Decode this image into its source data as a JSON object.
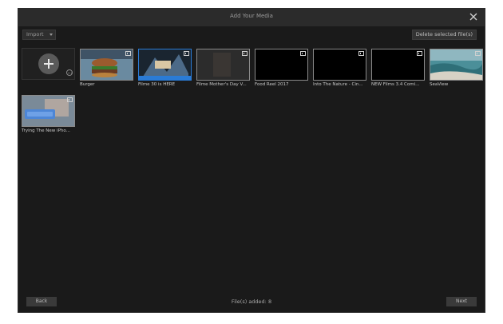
{
  "window": {
    "title": "Add Your Media"
  },
  "toolbar": {
    "import_label": "Import",
    "delete_label": "Delete selected file(s)"
  },
  "media": [
    {
      "name": "Burger"
    },
    {
      "name": "Filme 30 is HERE"
    },
    {
      "name": "Filme Mother's Day V..."
    },
    {
      "name": "Food Reel 2017"
    },
    {
      "name": "Into The Nature - Cin..."
    },
    {
      "name": "NEW Films 3.4 Comi..."
    },
    {
      "name": "SeaView"
    },
    {
      "name": "Trying The New iPho..."
    }
  ],
  "footer": {
    "back_label": "Back",
    "status": "File(s) added: 8",
    "next_label": "Next"
  },
  "icons": {
    "close": "close-icon",
    "add": "plus-icon",
    "more": "more-options-icon",
    "film": "film-icon",
    "dropdown": "chevron-down-icon"
  }
}
